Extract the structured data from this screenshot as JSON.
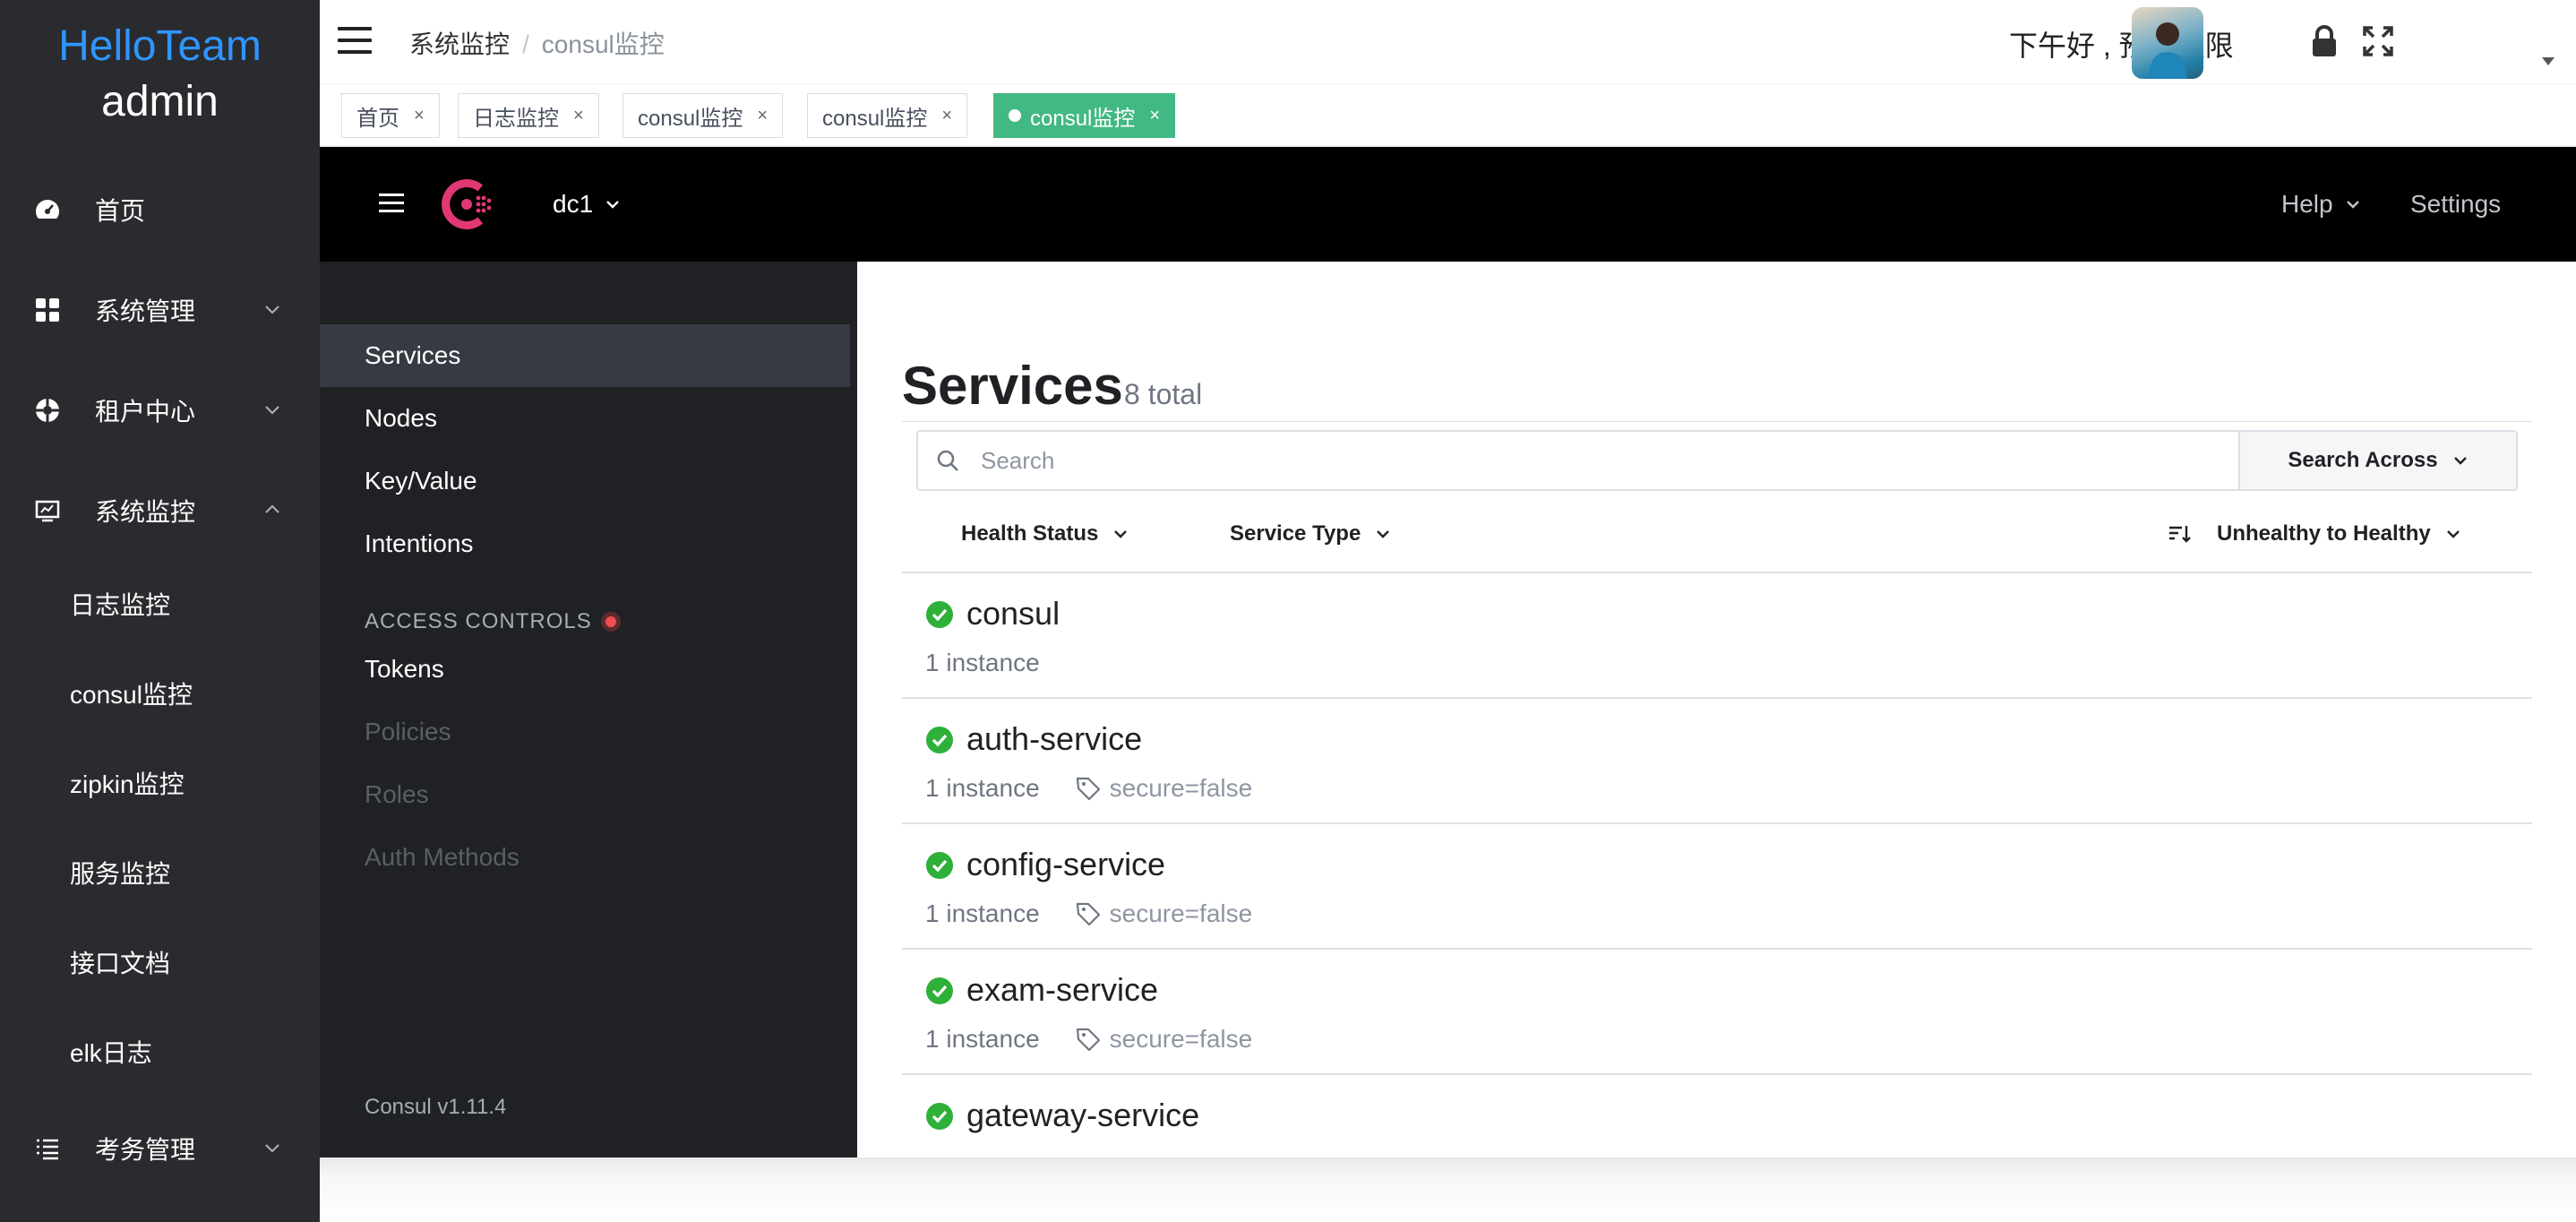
{
  "brand": {
    "name": "HelloTeam",
    "user": "admin"
  },
  "sidebar": {
    "items": [
      {
        "label": "首页",
        "icon": "dashboard-icon"
      },
      {
        "label": "系统管理",
        "icon": "grid-icon",
        "expandable": true
      },
      {
        "label": "租户中心",
        "icon": "support-icon",
        "expandable": true
      },
      {
        "label": "系统监控",
        "icon": "monitor-icon",
        "expanded": true
      }
    ],
    "sub_items": [
      "日志监控",
      "consul监控",
      "zipkin监控",
      "服务监控",
      "接口文档",
      "elk日志"
    ],
    "last_item": {
      "label": "考务管理",
      "icon": "list-icon",
      "expandable": true
    }
  },
  "header": {
    "breadcrumb": [
      "系统监控",
      "consul监控"
    ],
    "breadcrumb_separator": "/",
    "greeting": "下午好 , 预览权限"
  },
  "tabs": [
    {
      "label": "首页",
      "close": "×"
    },
    {
      "label": "日志监控",
      "close": "×"
    },
    {
      "label": "consul监控",
      "close": "×"
    },
    {
      "label": "consul监控",
      "close": "×"
    },
    {
      "label": "consul监控",
      "close": "×",
      "active": true
    }
  ],
  "consul": {
    "datacenter": "dc1",
    "help_label": "Help",
    "settings_label": "Settings",
    "nav": {
      "items": [
        "Services",
        "Nodes",
        "Key/Value",
        "Intentions"
      ],
      "selected": "Services",
      "access_section": "ACCESS CONTROLS",
      "access_items": [
        "Tokens",
        "Policies",
        "Roles",
        "Auth Methods"
      ],
      "version": "Consul v1.11.4"
    },
    "services_page": {
      "title": "Services",
      "count": "8 total",
      "search_placeholder": "Search",
      "search_across": "Search Across",
      "filters": [
        "Health Status",
        "Service Type"
      ],
      "sort": "Unhealthy to Healthy"
    },
    "services": [
      {
        "name": "consul",
        "instances": "1 instance",
        "tag": ""
      },
      {
        "name": "auth-service",
        "instances": "1 instance",
        "tag": "secure=false"
      },
      {
        "name": "config-service",
        "instances": "1 instance",
        "tag": "secure=false"
      },
      {
        "name": "exam-service",
        "instances": "1 instance",
        "tag": "secure=false"
      },
      {
        "name": "gateway-service",
        "instances": "",
        "tag": ""
      }
    ]
  },
  "colors": {
    "brand_blue": "#2f95ff",
    "tab_active": "#42b983",
    "consul_pink": "#e03875",
    "healthy_green": "#2eb039"
  }
}
